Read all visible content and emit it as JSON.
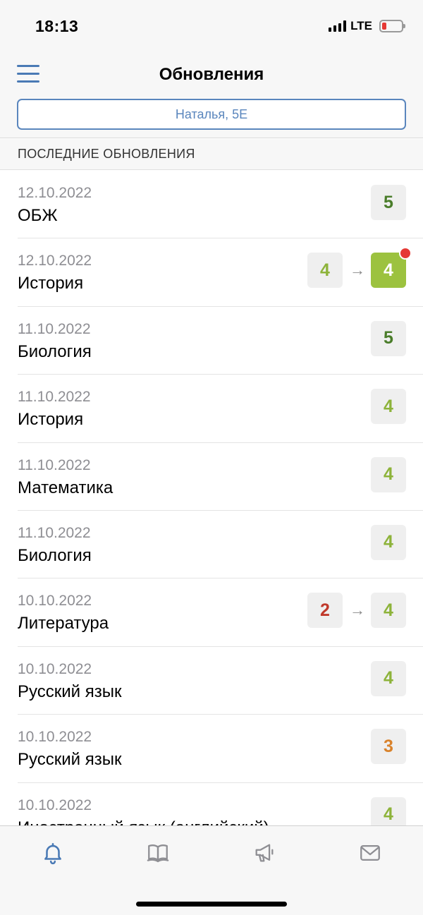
{
  "status": {
    "time": "18:13",
    "network": "LTE"
  },
  "header": {
    "title": "Обновления",
    "student": "Наталья, 5Е"
  },
  "section": {
    "title": "ПОСЛЕДНИЕ ОБНОВЛЕНИЯ"
  },
  "colors": {
    "accent": "#5a86bd",
    "grade5": "#4a7d2a",
    "grade4": "#8db33a",
    "grade3": "#d9822b",
    "grade2": "#c0392b",
    "highlight": "#9cc23f",
    "badge": "#e53935"
  },
  "updates": [
    {
      "date": "12.10.2022",
      "subject": "ОБЖ",
      "old": "",
      "grade": "5",
      "new_badge": false
    },
    {
      "date": "12.10.2022",
      "subject": "История",
      "old": "4",
      "grade": "4",
      "new_badge": true
    },
    {
      "date": "11.10.2022",
      "subject": "Биология",
      "old": "",
      "grade": "5",
      "new_badge": false
    },
    {
      "date": "11.10.2022",
      "subject": "История",
      "old": "",
      "grade": "4",
      "new_badge": false
    },
    {
      "date": "11.10.2022",
      "subject": "Математика",
      "old": "",
      "grade": "4",
      "new_badge": false
    },
    {
      "date": "11.10.2022",
      "subject": "Биология",
      "old": "",
      "grade": "4",
      "new_badge": false
    },
    {
      "date": "10.10.2022",
      "subject": "Литература",
      "old": "2",
      "grade": "4",
      "new_badge": false
    },
    {
      "date": "10.10.2022",
      "subject": "Русский язык",
      "old": "",
      "grade": "4",
      "new_badge": false
    },
    {
      "date": "10.10.2022",
      "subject": "Русский язык",
      "old": "",
      "grade": "3",
      "new_badge": false
    },
    {
      "date": "10.10.2022",
      "subject": "Иностранный язык (английский)",
      "old": "",
      "grade": "4",
      "new_badge": false
    }
  ],
  "tabs": [
    {
      "icon": "bell-icon",
      "active": true
    },
    {
      "icon": "book-icon",
      "active": false
    },
    {
      "icon": "megaphone-icon",
      "active": false
    },
    {
      "icon": "mail-icon",
      "active": false
    }
  ]
}
